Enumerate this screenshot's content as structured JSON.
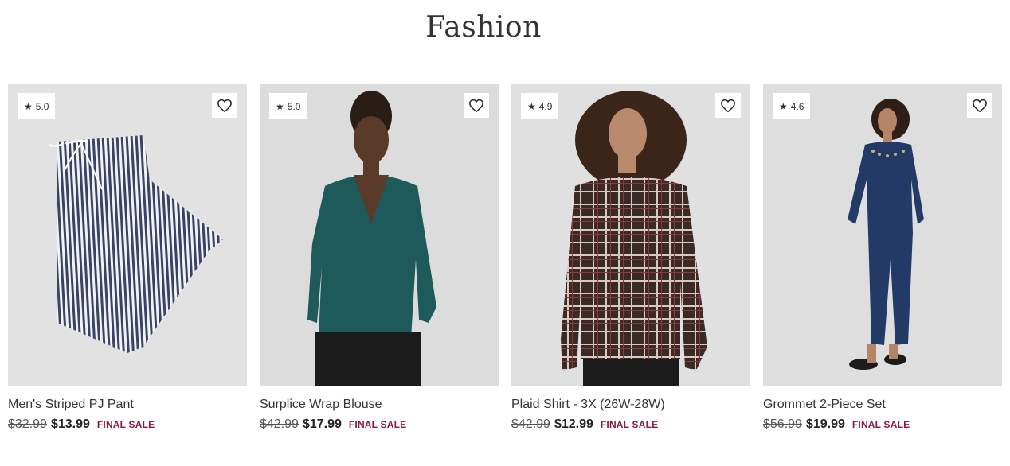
{
  "page": {
    "title": "Fashion"
  },
  "products": [
    {
      "rating": "5.0",
      "title": "Men's Striped PJ Pant",
      "was_price": "$32.99",
      "now_price": "$13.99",
      "sale_label": "FINAL SALE",
      "image": "striped-pajama-pants"
    },
    {
      "rating": "5.0",
      "title": "Surplice Wrap Blouse",
      "was_price": "$42.99",
      "now_price": "$17.99",
      "sale_label": "FINAL SALE",
      "image": "green-wrap-blouse"
    },
    {
      "rating": "4.9",
      "title": "Plaid Shirt - 3X (26W-28W)",
      "was_price": "$42.99",
      "now_price": "$12.99",
      "sale_label": "FINAL SALE",
      "image": "plaid-shirt"
    },
    {
      "rating": "4.6",
      "title": "Grommet 2-Piece Set",
      "was_price": "$56.99",
      "now_price": "$19.99",
      "sale_label": "FINAL SALE",
      "image": "navy-two-piece-set"
    }
  ],
  "icons": {
    "rating": "star-icon",
    "favorite": "heart-icon"
  },
  "colors": {
    "sale": "#8a1843",
    "image_bg": "#e1e1e1",
    "text": "#333333"
  }
}
